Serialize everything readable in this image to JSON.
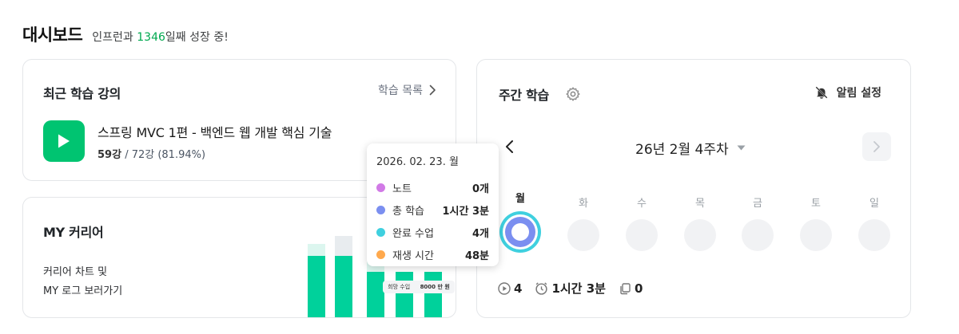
{
  "header": {
    "title": "대시보드",
    "subtitle_prefix": "인프런과 ",
    "subtitle_days": "1346",
    "subtitle_suffix": "일째 성장 중!"
  },
  "recent": {
    "title": "최근 학습 강의",
    "more_label": "학습 목록",
    "course_title": "스프링 MVC 1편 - 백엔드 웹 개발 핵심 기술",
    "progress_done": "59강",
    "progress_rest": " / 72강 (81.94%)"
  },
  "career": {
    "title": "MY 커리어",
    "desc_line1": "커리어 차트 및",
    "desc_line2": "MY 로그 보러가기",
    "mini_label_key": "희망 수입",
    "mini_label_value": "8000 만 원"
  },
  "weekly": {
    "title": "주간 학습",
    "alarm_label": "알림 설정",
    "week_label": "26년 2월 4주차",
    "days": [
      "월",
      "화",
      "수",
      "목",
      "금",
      "토",
      "일"
    ],
    "active_day_index": 0,
    "stats": {
      "lectures": "4",
      "time": "1시간 3분",
      "notes": "0"
    }
  },
  "tooltip": {
    "date": "2026. 02. 23. 월",
    "rows": [
      {
        "label": "노트",
        "value": "0개",
        "color": "#d17ae6"
      },
      {
        "label": "총 학습",
        "value": "1시간 3분",
        "color": "#7b8ff0"
      },
      {
        "label": "완료 수업",
        "value": "4개",
        "color": "#3fd0df"
      },
      {
        "label": "재생 시간",
        "value": "48분",
        "color": "#ffa94d"
      }
    ]
  },
  "colors": {
    "accent": "#00c471",
    "days_highlight": "#00a84f"
  }
}
